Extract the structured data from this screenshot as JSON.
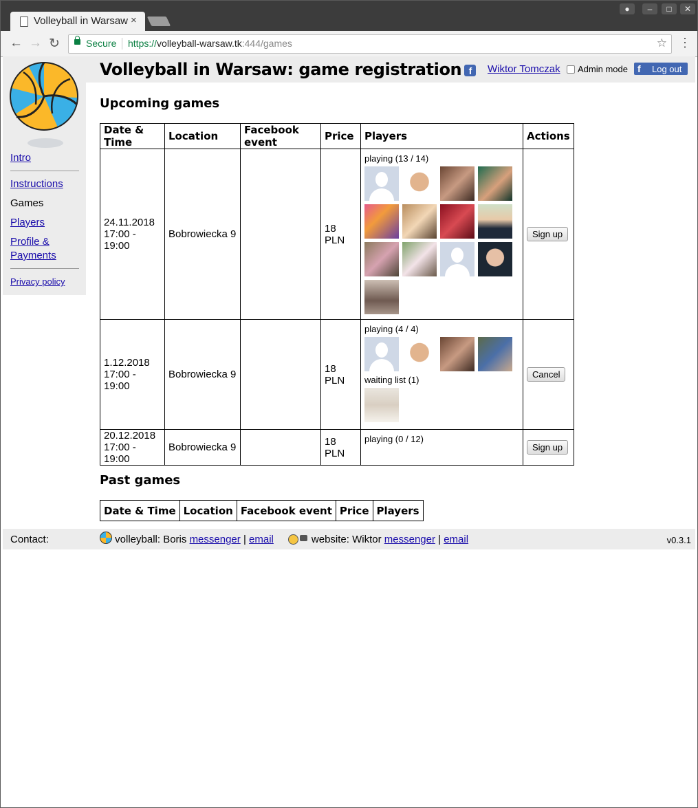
{
  "browser": {
    "tab_title": "Volleyball in Warsaw",
    "tab_close": "×",
    "secure_label": "Secure",
    "url_protocol": "https://",
    "url_host": "volleyball-warsaw.tk",
    "url_rest": ":444/games"
  },
  "header": {
    "title": "Volleyball in Warsaw: game registration",
    "user_name": "Wiktor Tomczak",
    "admin_mode_label": "Admin mode",
    "logout_label": "Log out"
  },
  "sidebar": {
    "intro": "Intro",
    "instructions": "Instructions",
    "games": "Games",
    "players": "Players",
    "profile_payments": "Profile & Payments",
    "privacy_policy": "Privacy policy"
  },
  "upcoming": {
    "heading": "Upcoming games",
    "columns": [
      "Date & Time",
      "Location",
      "Facebook event",
      "Price",
      "Players",
      "Actions"
    ],
    "rows": [
      {
        "date": "24.11.2018",
        "time": "17:00 - 19:00",
        "location": "Bobrowiecka 9",
        "facebook_event": "",
        "price": "18 PLN",
        "playing_label": "playing (13 / 14)",
        "action": "Sign up"
      },
      {
        "date": "1.12.2018",
        "time": "17:00 - 19:00",
        "location": "Bobrowiecka 9",
        "facebook_event": "",
        "price": "18 PLN",
        "playing_label": "playing (4 / 4)",
        "waiting_label": "waiting list (1)",
        "action": "Cancel"
      },
      {
        "date": "20.12.2018",
        "time": "17:00 - 19:00",
        "location": "Bobrowiecka 9",
        "facebook_event": "",
        "price": "18 PLN",
        "playing_label": "playing (0 / 12)",
        "action": "Sign up"
      }
    ]
  },
  "past": {
    "heading": "Past games",
    "columns": [
      "Date & Time",
      "Location",
      "Facebook event",
      "Price",
      "Players"
    ]
  },
  "footer": {
    "contact_label": "Contact:",
    "volleyball_prefix": "volleyball: Boris",
    "messenger_1": "messenger",
    "email_1": "email",
    "website_prefix": "website: Wiktor",
    "messenger_2": "messenger",
    "email_2": "email",
    "separator": "|",
    "version": "v0.3.1"
  }
}
